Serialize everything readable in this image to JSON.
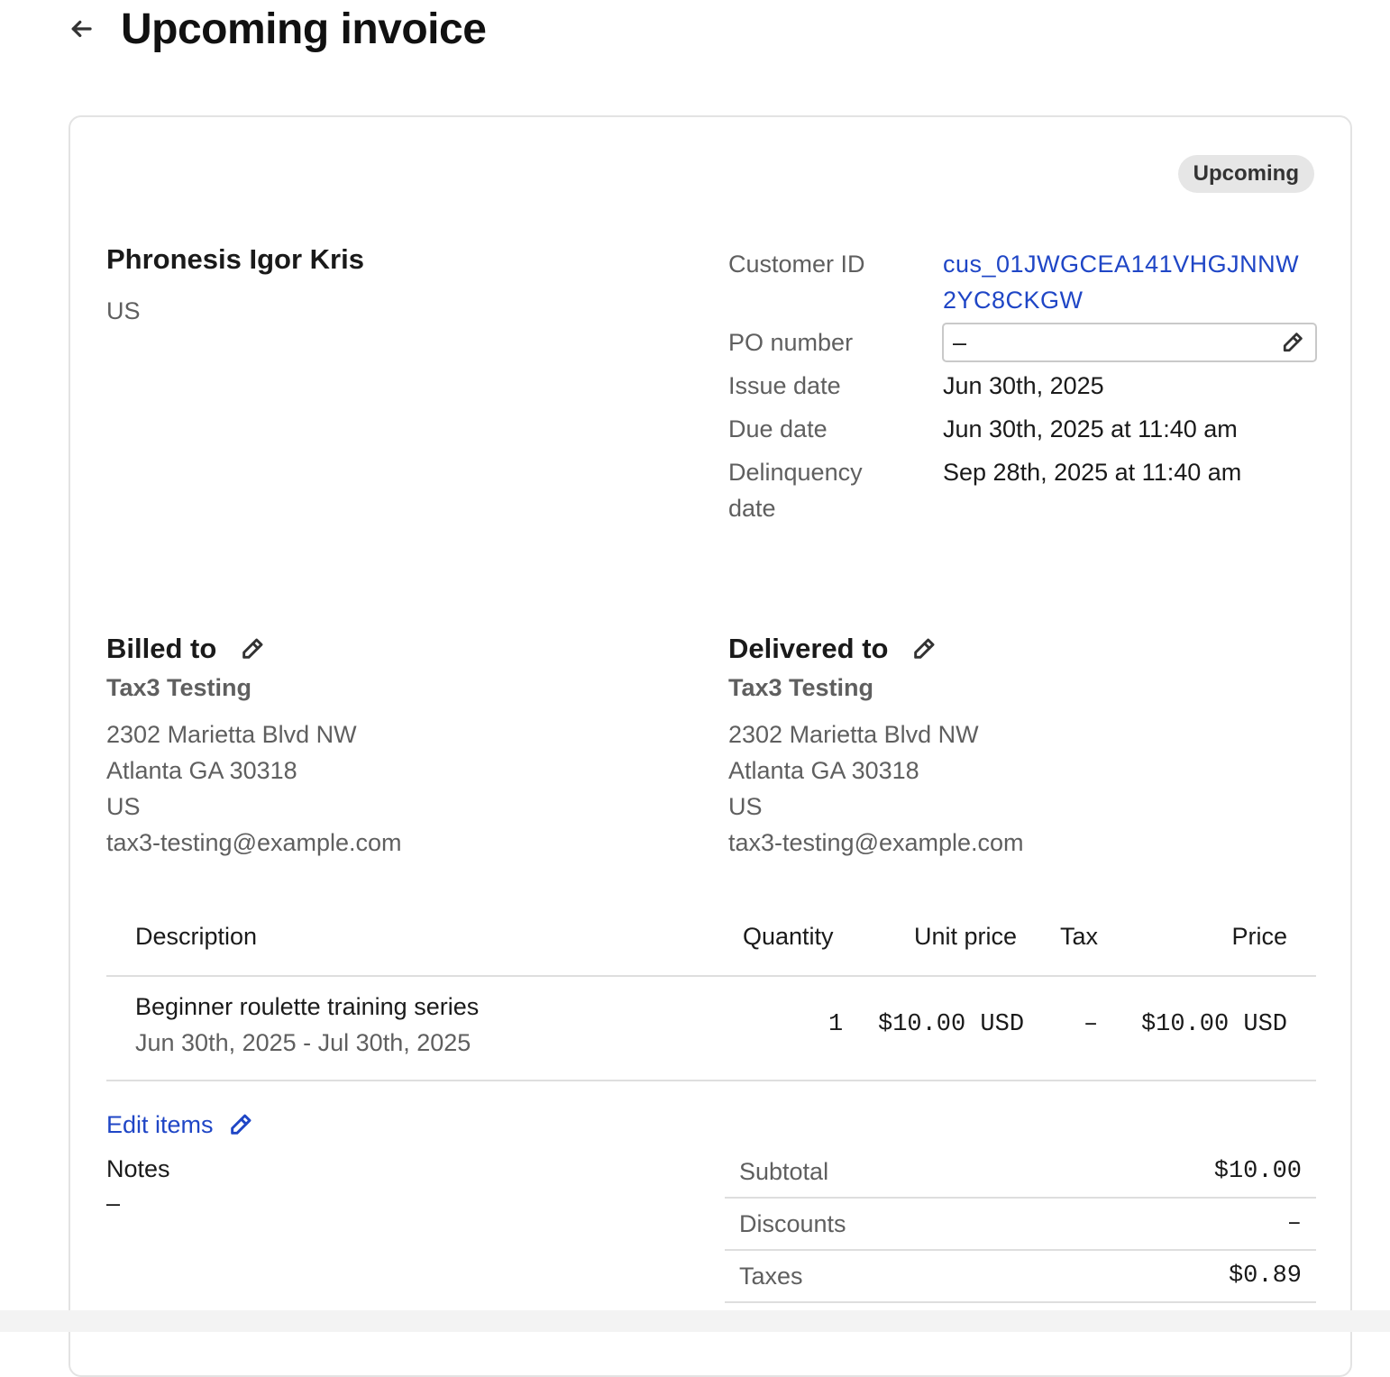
{
  "header": {
    "back_icon": "arrow-left-icon",
    "title": "Upcoming invoice"
  },
  "status_badge": "Upcoming",
  "customer": {
    "name": "Phronesis Igor Kris",
    "country": "US"
  },
  "meta": {
    "customer_id_label": "Customer ID",
    "customer_id_line1": "cus_01JWGCEA141VHGJNNW",
    "customer_id_line2": "2YC8CKGW",
    "po_label": "PO number",
    "po_value": "–",
    "issue_label": "Issue date",
    "issue_value": "Jun 30th, 2025",
    "due_label": "Due date",
    "due_value": "Jun 30th, 2025 at 11:40 am",
    "delinquency_label_line1": "Delinquency",
    "delinquency_label_line2": "date",
    "delinquency_value": "Sep 28th, 2025 at 11:40 am"
  },
  "billed_to": {
    "title": "Billed to",
    "company": "Tax3 Testing",
    "address": [
      "2302 Marietta Blvd NW",
      "Atlanta GA 30318",
      "US",
      "tax3-testing@example.com"
    ]
  },
  "delivered_to": {
    "title": "Delivered to",
    "company": "Tax3 Testing",
    "address": [
      "2302 Marietta Blvd NW",
      "Atlanta GA 30318",
      "US",
      "tax3-testing@example.com"
    ]
  },
  "table": {
    "headers": {
      "description": "Description",
      "quantity": "Quantity",
      "unit_price": "Unit price",
      "tax": "Tax",
      "price": "Price"
    },
    "rows": [
      {
        "description": "Beginner roulette training series",
        "period": "Jun 30th, 2025 - Jul 30th, 2025",
        "quantity": "1",
        "unit_price": "$10.00 USD",
        "tax": "–",
        "price": "$10.00 USD"
      }
    ]
  },
  "edit_items": "Edit items",
  "notes": {
    "title": "Notes",
    "value": "–"
  },
  "totals": {
    "subtotal_label": "Subtotal",
    "subtotal_value": "$10.00",
    "discounts_label": "Discounts",
    "discounts_value": "–",
    "taxes_label": "Taxes",
    "taxes_value": "$0.89"
  },
  "colors": {
    "link": "#1f46c6",
    "badge_bg": "#e6e6e6",
    "muted_text": "#5f5f5f",
    "border": "#e3e3e3"
  }
}
